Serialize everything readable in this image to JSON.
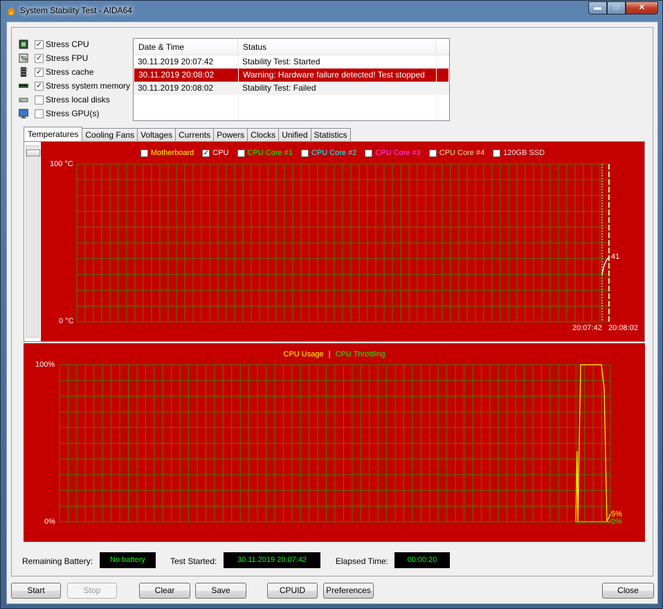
{
  "window": {
    "title": "System Stability Test - AIDA64",
    "buttons": {
      "minimize": "▬",
      "maximize": "□",
      "close": "✕"
    }
  },
  "stress": [
    {
      "label": "Stress CPU",
      "checked": true,
      "icon": "cpu-chip-icon"
    },
    {
      "label": "Stress FPU",
      "checked": true,
      "icon": "fpu-percent-icon"
    },
    {
      "label": "Stress cache",
      "checked": true,
      "icon": "cache-chip-icon"
    },
    {
      "label": "Stress system memory",
      "checked": true,
      "icon": "memory-module-icon"
    },
    {
      "label": "Stress local disks",
      "checked": false,
      "icon": "disk-drive-icon"
    },
    {
      "label": "Stress GPU(s)",
      "checked": false,
      "icon": "monitor-gpu-icon"
    }
  ],
  "log": {
    "columns": [
      "Date & Time",
      "Status"
    ],
    "rows": [
      {
        "date": "30.11.2019 20:07:42",
        "status": "Stability Test: Started",
        "style": "normal"
      },
      {
        "date": "30.11.2019 20:08:02",
        "status": "Warning: Hardware failure detected! Test stopped",
        "style": "alert"
      },
      {
        "date": "30.11.2019 20:08:02",
        "status": "Stability Test: Failed",
        "style": "gray"
      }
    ]
  },
  "tabs": [
    "Temperatures",
    "Cooling Fans",
    "Voltages",
    "Currents",
    "Powers",
    "Clocks",
    "Unified",
    "Statistics"
  ],
  "active_tab": "Temperatures",
  "temp_chart": {
    "legend": [
      {
        "label": "Motherboard",
        "checked": false,
        "color": "#ffff00"
      },
      {
        "label": "CPU",
        "checked": true,
        "color": "#ffffff"
      },
      {
        "label": "CPU Core #1",
        "checked": false,
        "color": "#00ff00"
      },
      {
        "label": "CPU Core #2",
        "checked": false,
        "color": "#00ffff"
      },
      {
        "label": "CPU Core #3",
        "checked": false,
        "color": "#ff40ff"
      },
      {
        "label": "CPU Core #4",
        "checked": false,
        "color": "#e0e0a0"
      },
      {
        "label": "120GB SSD",
        "checked": false,
        "color": "#e8e8e8"
      }
    ],
    "y_max_label": "100 °C",
    "y_min_label": "0 °C",
    "time_start": "20:07:42",
    "time_end": "20:08:02",
    "current_value": "41"
  },
  "usage_chart": {
    "legend_usage": "CPU Usage",
    "legend_sep": "|",
    "legend_throttle": "CPU Throttling",
    "y_max_label": "100%",
    "y_min_label": "0%",
    "usage_value": "5%",
    "throttle_value": "0%"
  },
  "chart_data": [
    {
      "type": "line",
      "series": [
        {
          "name": "CPU",
          "x": [
            "20:07:42",
            "20:08:02"
          ],
          "values": [
            30,
            41
          ]
        }
      ],
      "ylim": [
        0,
        100
      ],
      "ylabel": "°C",
      "grid": true
    },
    {
      "type": "line",
      "series": [
        {
          "name": "CPU Usage",
          "values": [
            0,
            100,
            100,
            5
          ]
        },
        {
          "name": "CPU Throttling",
          "values": [
            0,
            0,
            0,
            0
          ]
        }
      ],
      "ylim": [
        0,
        100
      ],
      "grid": true
    }
  ],
  "colors": {
    "chart_bg": "#c40000",
    "grid": "#4a7a00",
    "usage": "#ffff00",
    "throttle": "#00ff00",
    "alert_row": "#c00000",
    "info_text": "#00ff00"
  },
  "info": {
    "battery_label": "Remaining Battery:",
    "battery_value": "No battery",
    "started_label": "Test Started:",
    "started_value": "30.11.2019 20:07:42",
    "elapsed_label": "Elapsed Time:",
    "elapsed_value": "00:00:20"
  },
  "buttons": {
    "start": "Start",
    "stop": "Stop",
    "clear": "Clear",
    "save": "Save",
    "cpuid": "CPUID",
    "preferences": "Preferences",
    "close": "Close"
  }
}
